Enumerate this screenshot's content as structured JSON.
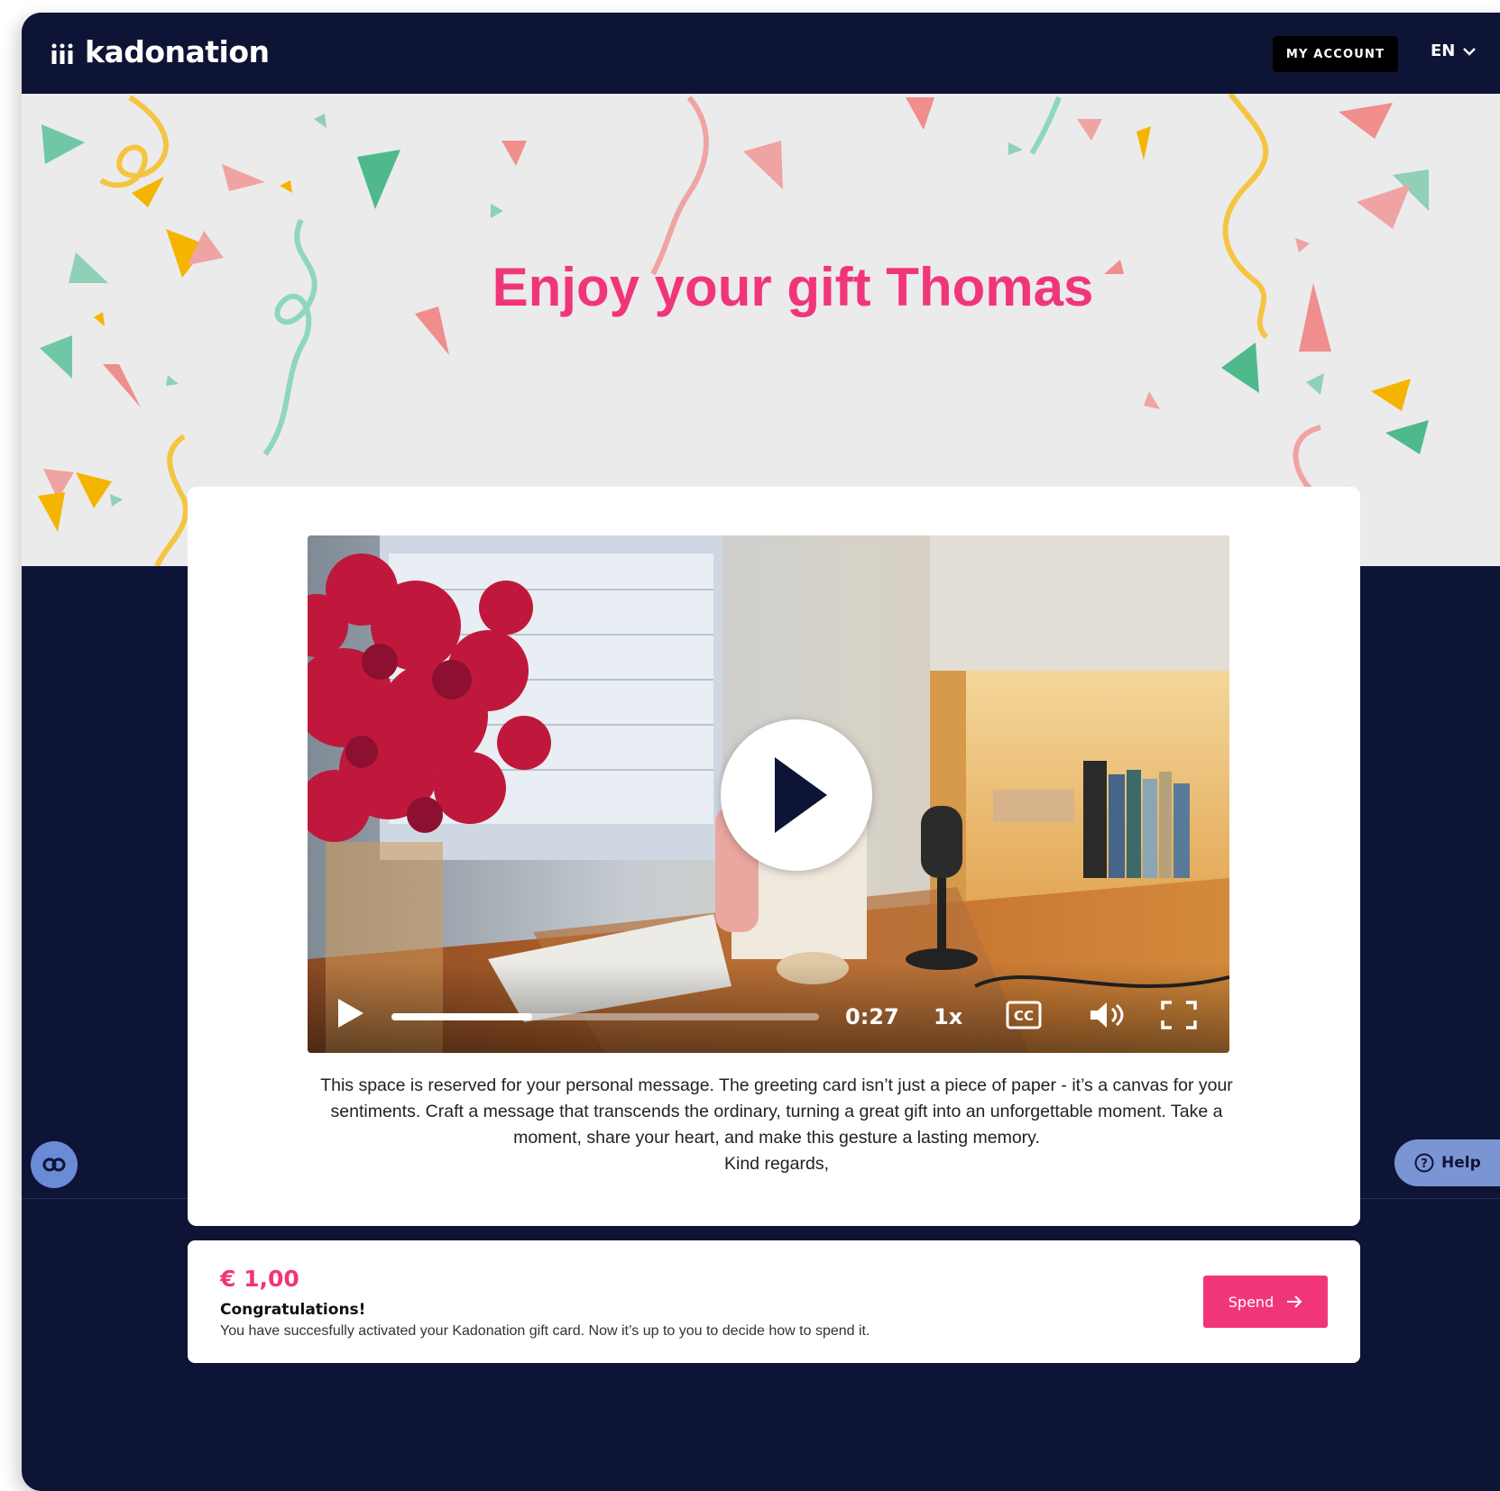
{
  "header": {
    "logo_text": "kadonation",
    "account_label": "MY ACCOUNT",
    "language": "EN"
  },
  "hero": {
    "title": "Enjoy your gift Thomas"
  },
  "video": {
    "time": "0:27",
    "speed": "1x",
    "progress": 0.33,
    "icons": [
      "play-icon",
      "closed-captions-icon",
      "volume-icon",
      "fullscreen-icon"
    ]
  },
  "message": {
    "body": "This space is reserved for your personal message. The greeting card isn’t just a piece of paper - it’s a canvas for your sentiments. Craft a message that transcends the ordinary, turning a great gift into an unforgettable moment. Take a moment, share your heart, and make this gesture a lasting memory.",
    "closing": "Kind regards,"
  },
  "gift": {
    "amount": "€ 1,00",
    "title": "Congratulations!",
    "description": "You have succesfully activated your Kadonation gift card. Now it’s up to you to decide how to spend it.",
    "spend_label": "Spend"
  },
  "help": {
    "label": "Help"
  },
  "colors": {
    "navy": "#0e1436",
    "accent": "#f1357a",
    "hero_bg": "#ebebeb",
    "help": "#7b95d4"
  }
}
